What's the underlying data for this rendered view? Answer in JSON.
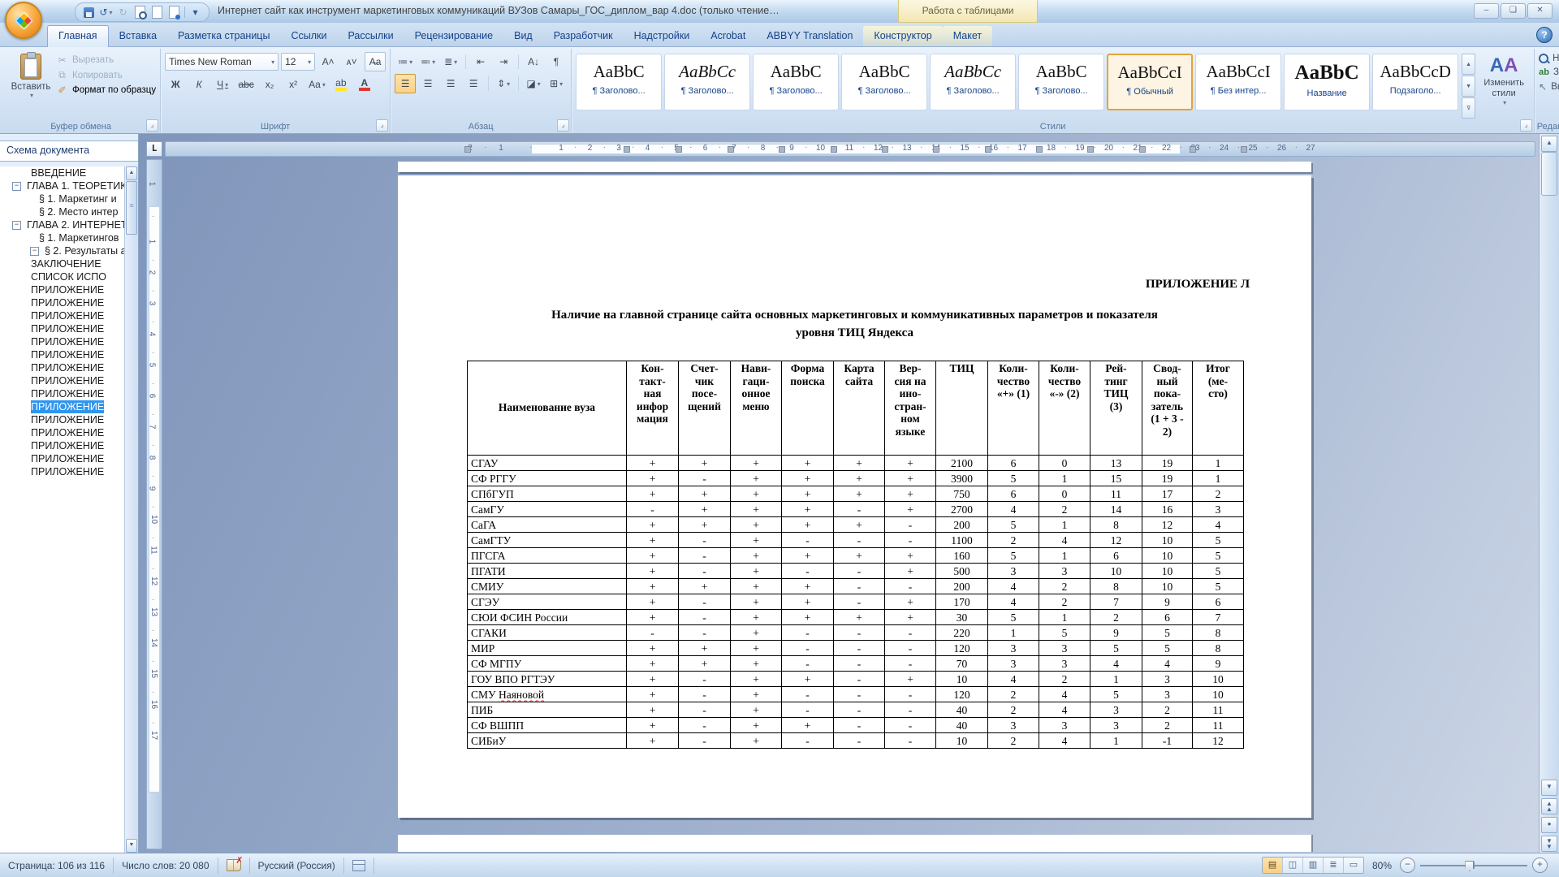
{
  "window": {
    "title": "Интернет сайт как инструмент маркетинговых коммуникаций ВУЗов Самары_ГОС_диплом_вар 4.doc (только чтение…",
    "context_group": "Работа с таблицами",
    "minimize": "–",
    "maximize": "❏",
    "close": "✕"
  },
  "ribbon": {
    "tabs": [
      {
        "label": "Главная",
        "active": true
      },
      {
        "label": "Вставка"
      },
      {
        "label": "Разметка страницы"
      },
      {
        "label": "Ссылки"
      },
      {
        "label": "Рассылки"
      },
      {
        "label": "Рецензирование"
      },
      {
        "label": "Вид"
      },
      {
        "label": "Разработчик"
      },
      {
        "label": "Надстройки"
      },
      {
        "label": "Acrobat"
      },
      {
        "label": "ABBYY Translation"
      },
      {
        "label": "Конструктор",
        "contextual": true
      },
      {
        "label": "Макет",
        "contextual": true
      }
    ],
    "clipboard": {
      "label": "Буфер обмена",
      "paste": "Вставить",
      "cut": "Вырезать",
      "copy": "Копировать",
      "format_painter": "Формат по образцу"
    },
    "font": {
      "label": "Шрифт",
      "family": "Times New Roman",
      "size": "12"
    },
    "paragraph": {
      "label": "Абзац"
    },
    "styles": {
      "label": "Стили",
      "change": "Изменить стили",
      "items": [
        {
          "preview": "AaBbC",
          "label": "¶ Заголово...",
          "italic": false
        },
        {
          "preview": "AaBbCc",
          "label": "¶ Заголово...",
          "italic": true
        },
        {
          "preview": "AaBbC",
          "label": "¶ Заголово..."
        },
        {
          "preview": "AaBbC",
          "label": "¶ Заголово..."
        },
        {
          "preview": "AaBbCc",
          "label": "¶ Заголово...",
          "italic": true
        },
        {
          "preview": "AaBbC",
          "label": "¶ Заголово..."
        },
        {
          "preview": "AaBbCcI",
          "label": "¶ Обычный",
          "selected": true
        },
        {
          "preview": "AaBbCcI",
          "label": "¶ Без интер..."
        },
        {
          "preview": "AaBbC",
          "label": "Название",
          "big": true
        },
        {
          "preview": "AaBbCcD",
          "label": "Подзаголо..."
        }
      ]
    },
    "editing": {
      "label": "Редактирование",
      "find": "Найти",
      "replace": "Заменить",
      "select": "Выделить"
    }
  },
  "document_map": {
    "header": "Схема документа",
    "items": [
      {
        "label": "ВВЕДЕНИЕ",
        "indent": 38
      },
      {
        "label": "ГЛАВА 1. ТЕОРЕТИК",
        "indent": 33,
        "expander": true
      },
      {
        "label": "§ 1. Маркетинг и",
        "indent": 48
      },
      {
        "label": "§ 2. Место интер",
        "indent": 48
      },
      {
        "label": "ГЛАВА 2.  ИНТЕРНЕТ",
        "indent": 33,
        "expander": true
      },
      {
        "label": "§ 1. Маркетингов",
        "indent": 48
      },
      {
        "label": "§ 2. Результаты а",
        "indent": 55,
        "expander": true
      },
      {
        "label": "ЗАКЛЮЧЕНИЕ",
        "indent": 38
      },
      {
        "label": "СПИСОК ИСПО",
        "indent": 38
      },
      {
        "label": "ПРИЛОЖЕНИЕ",
        "indent": 38
      },
      {
        "label": "ПРИЛОЖЕНИЕ",
        "indent": 38
      },
      {
        "label": "ПРИЛОЖЕНИЕ",
        "indent": 38
      },
      {
        "label": "ПРИЛОЖЕНИЕ",
        "indent": 38
      },
      {
        "label": "ПРИЛОЖЕНИЕ",
        "indent": 38
      },
      {
        "label": "ПРИЛОЖЕНИЕ",
        "indent": 38
      },
      {
        "label": "ПРИЛОЖЕНИЕ",
        "indent": 38
      },
      {
        "label": "ПРИЛОЖЕНИЕ",
        "indent": 38
      },
      {
        "label": "ПРИЛОЖЕНИЕ",
        "indent": 38
      },
      {
        "label": "ПРИЛОЖЕНИЕ",
        "indent": 38,
        "selected": true
      },
      {
        "label": "ПРИЛОЖЕНИЕ",
        "indent": 38
      },
      {
        "label": "ПРИЛОЖЕНИЕ",
        "indent": 38
      },
      {
        "label": "ПРИЛОЖЕНИЕ",
        "indent": 38
      },
      {
        "label": "ПРИЛОЖЕНИЕ",
        "indent": 38
      },
      {
        "label": "ПРИЛОЖЕНИЕ",
        "indent": 38
      }
    ]
  },
  "page": {
    "appendix": "ПРИЛОЖЕНИЕ Л",
    "title_line1": "Наличие на главной странице сайта основных маркетинговых и коммуникативных параметров и показателя",
    "title_line2": "уровня ТИЦ Яндекса",
    "spell_error_word": "Наяновой",
    "table": {
      "headers": [
        "Наименование вуза",
        "Кон-\nтакт-\nная\nинфор\nмация",
        "Счет-\nчик\nпосе-\nщений",
        "Нави-\nгаци-\nонное\nменю",
        "Форма\nпоиска",
        "Карта\nсайта",
        "Вер-\nсия на\nино-\nстран-\nном\nязыке",
        "ТИЦ",
        "Коли-\nчество\n«+» (1)",
        "Коли-\nчество\n«-» (2)",
        "Рей-\nтинг\nТИЦ\n(3)",
        "Свод-\nный\nпока-\nзатель\n(1 + 3 -\n2)",
        "Итог\n(ме-\nсто)"
      ],
      "rows": [
        [
          "СГАУ",
          "+",
          "+",
          "+",
          "+",
          "+",
          "+",
          "2100",
          "6",
          "0",
          "13",
          "19",
          "1"
        ],
        [
          "СФ РГГУ",
          "+",
          "-",
          "+",
          "+",
          "+",
          "+",
          "3900",
          "5",
          "1",
          "15",
          "19",
          "1"
        ],
        [
          "СПбГУП",
          "+",
          "+",
          "+",
          "+",
          "+",
          "+",
          "750",
          "6",
          "0",
          "11",
          "17",
          "2"
        ],
        [
          "СамГУ",
          "-",
          "+",
          "+",
          "+",
          "-",
          "+",
          "2700",
          "4",
          "2",
          "14",
          "16",
          "3"
        ],
        [
          "СаГА",
          "+",
          "+",
          "+",
          "+",
          "+",
          "-",
          "200",
          "5",
          "1",
          "8",
          "12",
          "4"
        ],
        [
          "СамГТУ",
          "+",
          "-",
          "+",
          "-",
          "-",
          "-",
          "1100",
          "2",
          "4",
          "12",
          "10",
          "5"
        ],
        [
          "ПГСГА",
          "+",
          "-",
          "+",
          "+",
          "+",
          "+",
          "160",
          "5",
          "1",
          "6",
          "10",
          "5"
        ],
        [
          "ПГАТИ",
          "+",
          "-",
          "+",
          "-",
          "-",
          "+",
          "500",
          "3",
          "3",
          "10",
          "10",
          "5"
        ],
        [
          "СМИУ",
          "+",
          "+",
          "+",
          "+",
          "-",
          "-",
          "200",
          "4",
          "2",
          "8",
          "10",
          "5"
        ],
        [
          "СГЭУ",
          "+",
          "-",
          "+",
          "+",
          "-",
          "+",
          "170",
          "4",
          "2",
          "7",
          "9",
          "6"
        ],
        [
          "СЮИ ФСИН России",
          "+",
          "-",
          "+",
          "+",
          "+",
          "+",
          "30",
          "5",
          "1",
          "2",
          "6",
          "7"
        ],
        [
          "СГАКИ",
          "-",
          "-",
          "+",
          "-",
          "-",
          "-",
          "220",
          "1",
          "5",
          "9",
          "5",
          "8"
        ],
        [
          "МИР",
          "+",
          "+",
          "+",
          "-",
          "-",
          "-",
          "120",
          "3",
          "3",
          "5",
          "5",
          "8"
        ],
        [
          "СФ МГПУ",
          "+",
          "+",
          "+",
          "-",
          "-",
          "-",
          "70",
          "3",
          "3",
          "4",
          "4",
          "9"
        ],
        [
          "ГОУ ВПО РГТЭУ",
          "+",
          "-",
          "+",
          "+",
          "-",
          "+",
          "10",
          "4",
          "2",
          "1",
          "3",
          "10"
        ],
        [
          "СМУ Наяновой",
          "+",
          "-",
          "+",
          "-",
          "-",
          "-",
          "120",
          "2",
          "4",
          "5",
          "3",
          "10"
        ],
        [
          "ПИБ",
          "+",
          "-",
          "+",
          "-",
          "-",
          "-",
          "40",
          "2",
          "4",
          "3",
          "2",
          "11"
        ],
        [
          "СФ ВШПП",
          "+",
          "-",
          "+",
          "+",
          "-",
          "-",
          "40",
          "3",
          "3",
          "3",
          "2",
          "11"
        ],
        [
          "СИБиУ",
          "+",
          "-",
          "+",
          "-",
          "-",
          "-",
          "10",
          "2",
          "4",
          "1",
          "-1",
          "12"
        ]
      ]
    }
  },
  "ruler": {
    "h_margin": [
      "2",
      "1"
    ],
    "h_numbers": [
      "1",
      "2",
      "3",
      "4",
      "5",
      "6",
      "7",
      "8",
      "9",
      "10",
      "11",
      "12",
      "13",
      "14",
      "15",
      "16",
      "17",
      "18",
      "19",
      "20",
      "21",
      "22",
      "23",
      "24",
      "25",
      "26",
      "27"
    ],
    "v_margin": [
      "1"
    ],
    "v_numbers": [
      "1",
      "2",
      "3",
      "4",
      "5",
      "6",
      "7",
      "8",
      "9",
      "10",
      "11",
      "12",
      "13",
      "14",
      "15",
      "16",
      "17"
    ]
  },
  "status": {
    "page": "Страница: 106 из 116",
    "words": "Число слов: 20 080",
    "language": "Русский (Россия)",
    "zoom": "80%"
  }
}
